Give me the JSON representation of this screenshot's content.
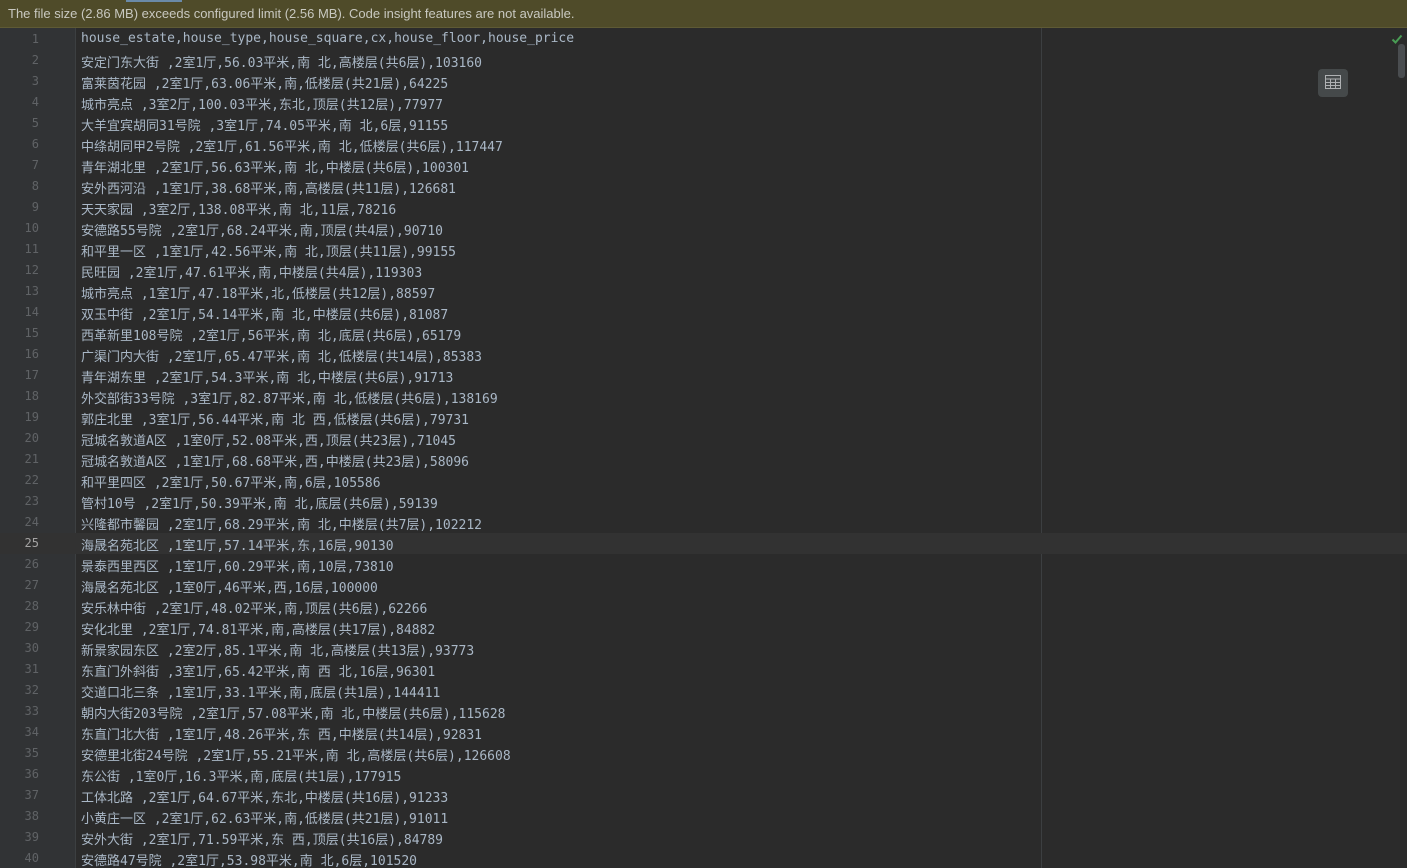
{
  "notification": {
    "text": "The file size (2.86 MB) exceeds configured limit (2.56 MB). Code insight features are not available."
  },
  "editor": {
    "current_line": 25,
    "lines": [
      {
        "num": "1",
        "text": "house_estate,house_type,house_square,cx,house_floor,house_price"
      },
      {
        "num": "2",
        "text": "安定门东大街 ,2室1厅,56.03平米,南 北,高楼层(共6层),103160"
      },
      {
        "num": "3",
        "text": "富莱茵花园 ,2室1厅,63.06平米,南,低楼层(共21层),64225"
      },
      {
        "num": "4",
        "text": "城市亮点 ,3室2厅,100.03平米,东北,顶层(共12层),77977"
      },
      {
        "num": "5",
        "text": "大羊宜宾胡同31号院 ,3室1厅,74.05平米,南 北,6层,91155"
      },
      {
        "num": "6",
        "text": "中绦胡同甲2号院 ,2室1厅,61.56平米,南 北,低楼层(共6层),117447"
      },
      {
        "num": "7",
        "text": "青年湖北里 ,2室1厅,56.63平米,南 北,中楼层(共6层),100301"
      },
      {
        "num": "8",
        "text": "安外西河沿 ,1室1厅,38.68平米,南,高楼层(共11层),126681"
      },
      {
        "num": "9",
        "text": "天天家园 ,3室2厅,138.08平米,南 北,11层,78216"
      },
      {
        "num": "10",
        "text": "安德路55号院 ,2室1厅,68.24平米,南,顶层(共4层),90710"
      },
      {
        "num": "11",
        "text": "和平里一区 ,1室1厅,42.56平米,南 北,顶层(共11层),99155"
      },
      {
        "num": "12",
        "text": "民旺园 ,2室1厅,47.61平米,南,中楼层(共4层),119303"
      },
      {
        "num": "13",
        "text": "城市亮点 ,1室1厅,47.18平米,北,低楼层(共12层),88597"
      },
      {
        "num": "14",
        "text": "双玉中街 ,2室1厅,54.14平米,南 北,中楼层(共6层),81087"
      },
      {
        "num": "15",
        "text": "西革新里108号院 ,2室1厅,56平米,南 北,底层(共6层),65179"
      },
      {
        "num": "16",
        "text": "广渠门内大街 ,2室1厅,65.47平米,南 北,低楼层(共14层),85383"
      },
      {
        "num": "17",
        "text": "青年湖东里 ,2室1厅,54.3平米,南 北,中楼层(共6层),91713"
      },
      {
        "num": "18",
        "text": "外交部街33号院 ,3室1厅,82.87平米,南 北,低楼层(共6层),138169"
      },
      {
        "num": "19",
        "text": "郭庄北里 ,3室1厅,56.44平米,南 北 西,低楼层(共6层),79731"
      },
      {
        "num": "20",
        "text": "冠城名敦道A区 ,1室0厅,52.08平米,西,顶层(共23层),71045"
      },
      {
        "num": "21",
        "text": "冠城名敦道A区 ,1室1厅,68.68平米,西,中楼层(共23层),58096"
      },
      {
        "num": "22",
        "text": "和平里四区 ,2室1厅,50.67平米,南,6层,105586"
      },
      {
        "num": "23",
        "text": "管村10号 ,2室1厅,50.39平米,南 北,底层(共6层),59139"
      },
      {
        "num": "24",
        "text": "兴隆都市馨园 ,2室1厅,68.29平米,南 北,中楼层(共7层),102212"
      },
      {
        "num": "25",
        "text": "海晟名苑北区 ,1室1厅,57.14平米,东,16层,90130"
      },
      {
        "num": "26",
        "text": "景泰西里西区 ,1室1厅,60.29平米,南,10层,73810"
      },
      {
        "num": "27",
        "text": "海晟名苑北区 ,1室0厅,46平米,西,16层,100000"
      },
      {
        "num": "28",
        "text": "安乐林中街 ,2室1厅,48.02平米,南,顶层(共6层),62266"
      },
      {
        "num": "29",
        "text": "安化北里 ,2室1厅,74.81平米,南,高楼层(共17层),84882"
      },
      {
        "num": "30",
        "text": "新景家园东区 ,2室2厅,85.1平米,南 北,高楼层(共13层),93773"
      },
      {
        "num": "31",
        "text": "东直门外斜街 ,3室1厅,65.42平米,南 西 北,16层,96301"
      },
      {
        "num": "32",
        "text": "交道口北三条 ,1室1厅,33.1平米,南,底层(共1层),144411"
      },
      {
        "num": "33",
        "text": "朝内大街203号院 ,2室1厅,57.08平米,南 北,中楼层(共6层),115628"
      },
      {
        "num": "34",
        "text": "东直门北大街 ,1室1厅,48.26平米,东 西,中楼层(共14层),92831"
      },
      {
        "num": "35",
        "text": "安德里北街24号院 ,2室1厅,55.21平米,南 北,高楼层(共6层),126608"
      },
      {
        "num": "36",
        "text": "东公街 ,1室0厅,16.3平米,南,底层(共1层),177915"
      },
      {
        "num": "37",
        "text": "工体北路 ,2室1厅,64.67平米,东北,中楼层(共16层),91233"
      },
      {
        "num": "38",
        "text": "小黄庄一区 ,2室1厅,62.63平米,南,低楼层(共21层),91011"
      },
      {
        "num": "39",
        "text": "安外大街 ,2室1厅,71.59平米,东 西,顶层(共16层),84789"
      },
      {
        "num": "40",
        "text": "安德路47号院 ,2室1厅,53.98平米,南 北,6层,101520"
      }
    ]
  },
  "icons": {
    "inspection_status": "check-icon",
    "table_view": "table-view-icon"
  },
  "colors": {
    "background": "#2b2b2b",
    "gutter": "#313335",
    "notice_bar": "#4f4b29",
    "text": "#a9b7c6",
    "line_number": "#606366",
    "check": "#499c54"
  }
}
